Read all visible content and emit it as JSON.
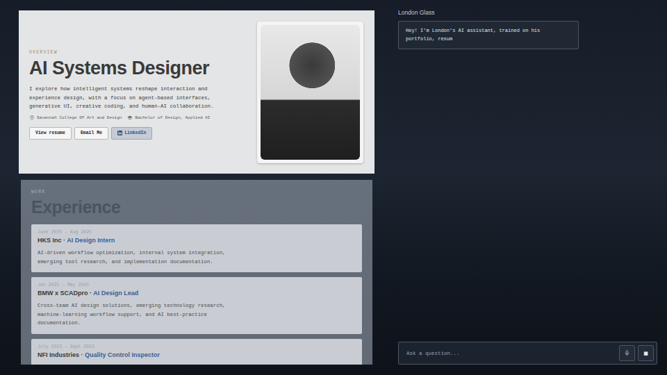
{
  "overview": {
    "label": "OVERVIEW",
    "title": "AI Systems Designer",
    "description": "I explore how intelligent systems reshape interaction and experience design, with a focus on agent-based interfaces, generative UI, creative coding, and human-AI collaboration.",
    "school": "Savannah College Of Art and Design",
    "degree": "Bachelor of Design, Applied AI",
    "buttons": [
      {
        "label": "View resume",
        "kind": "plain"
      },
      {
        "label": "Email Me",
        "kind": "plain"
      },
      {
        "label": "LinkedIn",
        "kind": "social"
      }
    ]
  },
  "experience": {
    "label": "WORK",
    "title": "Experience",
    "separator": "·",
    "items": [
      {
        "dates": "June 2025 – Aug 2025",
        "company": "HKS Inc",
        "role": "AI Design Intern",
        "description": "AI-driven workflow optimization, internal system integration, emerging tool research, and implementation documentation."
      },
      {
        "dates": "Jan 2025 – May 2025",
        "company": "BMW x SCADpro",
        "role": "AI Design Lead",
        "description": "Cross-team AI design solutions, emerging technology research, machine-learning workflow support, and AI best-practice documentation."
      },
      {
        "dates": "July 2023 – Sept 2023",
        "company": "NFI Industries",
        "role": "Quality Control Inspector",
        "description": ""
      }
    ]
  },
  "chat": {
    "title": "London Glass",
    "messages": [
      {
        "text": "Hey! I’m London’s AI assistant, trained on his portfolio, resum"
      }
    ],
    "input": {
      "placeholder": "Ask a question..."
    },
    "stop_button": "■"
  }
}
